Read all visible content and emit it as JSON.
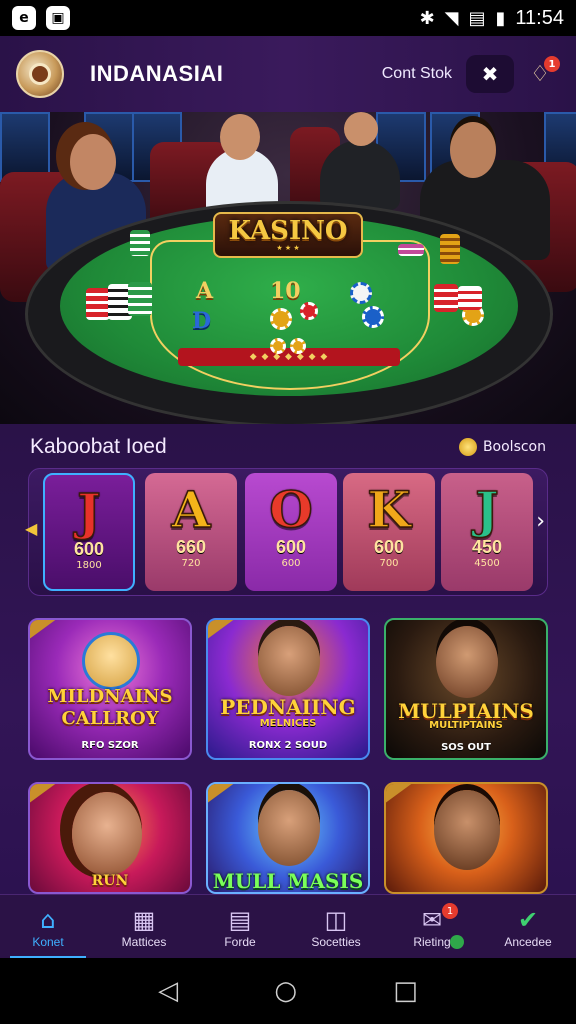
{
  "status_bar": {
    "time": "11:54",
    "left_icons": [
      "app-e-icon",
      "app-gallery-icon"
    ],
    "right_icons": [
      "bluetooth-icon",
      "wifi-icon",
      "signal-icon",
      "battery-icon"
    ]
  },
  "header": {
    "title": "INDANASIAI",
    "link": "Cont Stok",
    "notification_count": "1"
  },
  "hero": {
    "table_sign": "KASINO",
    "felt_labels": [
      "A",
      "10",
      "D"
    ]
  },
  "section": {
    "title": "Kaboobat Ioed",
    "right_label": "Boolscon"
  },
  "cards": [
    {
      "letter": "J",
      "value": "600",
      "sub": "1800",
      "color": "#e8322a",
      "bg": "#6a1a8a"
    },
    {
      "letter": "A",
      "value": "660",
      "sub": "720",
      "color": "#f4b41a",
      "bg": "#c0507a"
    },
    {
      "letter": "O",
      "value": "600",
      "sub": "600",
      "color": "#e83a2a",
      "bg": "#a03ab8"
    },
    {
      "letter": "K",
      "value": "600",
      "sub": "700",
      "color": "#f0a81a",
      "bg": "#c0506a"
    },
    {
      "letter": "J",
      "value": "450",
      "sub": "4500",
      "color": "#2ac08a",
      "bg": "#b04a7a"
    }
  ],
  "games": [
    {
      "title": "MILDNAINS CALLROY",
      "sub": "RFO SZOR"
    },
    {
      "title": "PEDNAIING",
      "subtitle": "MELNICES",
      "sub": "RONX 2 SOUD"
    },
    {
      "title": "MULPIAINS",
      "subtitle": "MULTIPTAINS",
      "sub": "SOS OUT"
    },
    {
      "title": "RUN",
      "sub": ""
    },
    {
      "title": "MULL MASIS",
      "sub": ""
    },
    {
      "title": "",
      "sub": ""
    }
  ],
  "bottom_nav": [
    {
      "label": "Konet",
      "icon": "home-icon",
      "active": true
    },
    {
      "label": "Mattices",
      "icon": "calendar-icon",
      "active": false
    },
    {
      "label": "Forde",
      "icon": "document-icon",
      "active": false
    },
    {
      "label": "Socetties",
      "icon": "chart-icon",
      "active": false
    },
    {
      "label": "Rieting",
      "icon": "mail-icon",
      "active": false,
      "badge": "1"
    },
    {
      "label": "Ancedee",
      "icon": "user-check-icon",
      "active": false
    }
  ]
}
